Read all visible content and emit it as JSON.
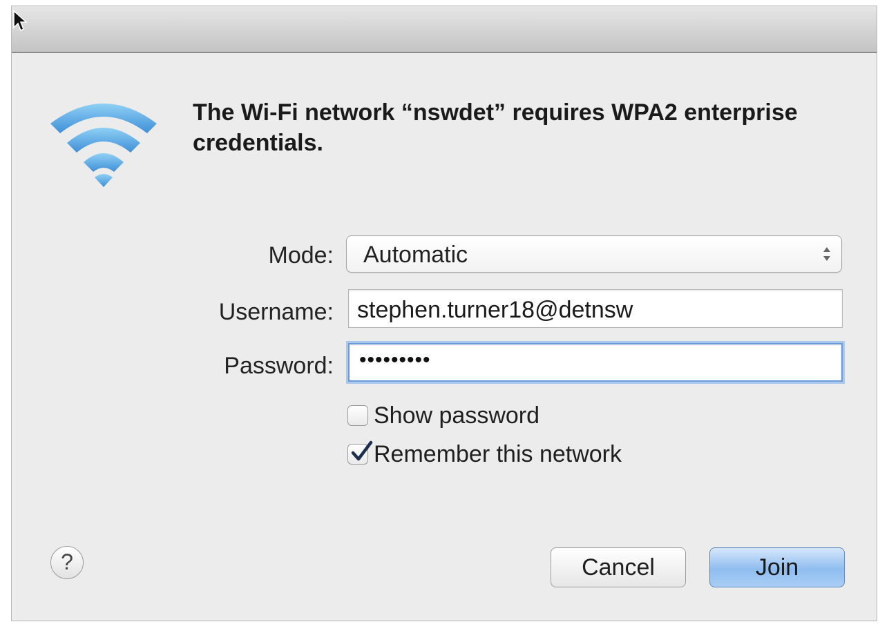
{
  "dialog": {
    "headline": "The Wi-Fi network “nswdet” requires WPA2 enterprise credentials.",
    "accent_color": "#5aa6e8",
    "icon": "wifi-icon"
  },
  "form": {
    "mode": {
      "label": "Mode:",
      "value": "Automatic"
    },
    "username": {
      "label": "Username:",
      "value": "stephen.turner18@detnsw"
    },
    "password": {
      "label": "Password:",
      "masked_value": "•••••••••"
    },
    "show_password": {
      "label": "Show password",
      "checked": false
    },
    "remember_network": {
      "label": "Remember this network",
      "checked": true
    }
  },
  "footer": {
    "help_label": "?",
    "cancel_label": "Cancel",
    "join_label": "Join"
  }
}
